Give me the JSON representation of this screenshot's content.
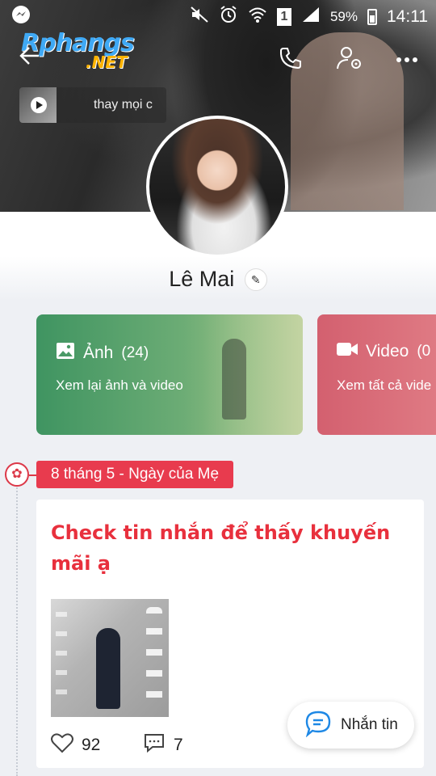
{
  "status_bar": {
    "battery_percent": "59%",
    "time": "14:11",
    "sim_label": "1"
  },
  "brand": {
    "logo_main": "Rphangs",
    "logo_sub": ".NET"
  },
  "story": {
    "text": "thay mọi c"
  },
  "profile": {
    "name": "Lê Mai"
  },
  "cards": {
    "photo": {
      "title": "Ảnh",
      "count": "(24)",
      "subtitle": "Xem lại ảnh và video"
    },
    "video": {
      "title": "Video",
      "count": "(0",
      "subtitle": "Xem tất cả vide"
    }
  },
  "timeline": {
    "tag": "8 tháng 5 - Ngày của Mẹ"
  },
  "post": {
    "message": "Check tin nhắn để thấy khuyến mãi ạ",
    "likes": "92",
    "comments": "7"
  },
  "chat_button": {
    "label": "Nhắn tin"
  },
  "colors": {
    "accent_red": "#e83b4e",
    "photo_card": "#3f9461",
    "video_card": "#d3606f",
    "chat_blue": "#1e88e5"
  }
}
